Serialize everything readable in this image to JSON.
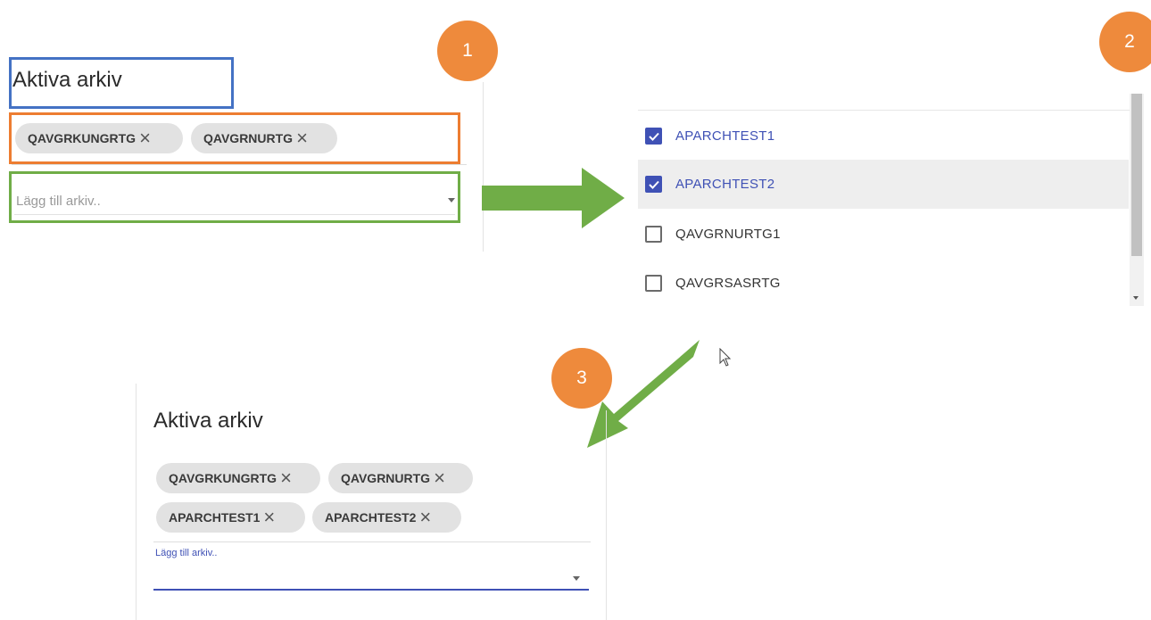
{
  "steps": [
    "1",
    "2",
    "3"
  ],
  "before": {
    "title": "Aktiva arkiv",
    "chips": [
      "QAVGRKUNGRTG",
      "QAVGRNURTG"
    ],
    "placeholder": "Lägg till arkiv.."
  },
  "dropdown": {
    "options": [
      {
        "label": "APARCHTEST1",
        "checked": true
      },
      {
        "label": "APARCHTEST2",
        "checked": true
      },
      {
        "label": "QAVGRNURTG1",
        "checked": false
      },
      {
        "label": "QAVGRSASRTG",
        "checked": false
      }
    ]
  },
  "after": {
    "title": "Aktiva arkiv",
    "chips_row1": [
      "QAVGRKUNGRTG",
      "QAVGRNURTG"
    ],
    "chips_row2": [
      "APARCHTEST1",
      "APARCHTEST2"
    ],
    "floating_label": "Lägg till arkiv.."
  },
  "colors": {
    "badge": "#ee8a3c",
    "arrow": "#70ad47",
    "title_box": "#4472c4",
    "chips_box": "#ed7d31",
    "input_box": "#70ad47",
    "accent": "#3f51b5"
  }
}
